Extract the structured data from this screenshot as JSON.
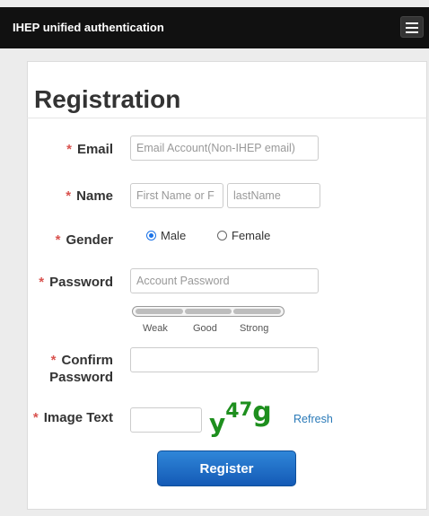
{
  "header": {
    "brand": "IHEP unified authentication",
    "menu_icon": "hamburger-menu-icon"
  },
  "form": {
    "title": "Registration",
    "required_marker": "*",
    "email": {
      "label": "Email",
      "placeholder": "Email Account(Non-IHEP email)",
      "value": ""
    },
    "name": {
      "label": "Name",
      "first_placeholder": "First Name or F",
      "last_placeholder": "lastName",
      "first_value": "",
      "last_value": ""
    },
    "gender": {
      "label": "Gender",
      "options": [
        "Male",
        "Female"
      ],
      "selected": "Male"
    },
    "password": {
      "label": "Password",
      "placeholder": "Account Password",
      "value": "",
      "strength_labels": [
        "Weak",
        "Good",
        "Strong"
      ]
    },
    "confirm_password": {
      "label_line1": "Confirm",
      "label_line2": "Password",
      "value": ""
    },
    "image_text": {
      "label": "Image Text",
      "value": "",
      "captcha_chars": [
        "y",
        "4",
        "7",
        "g"
      ],
      "refresh_label": "Refresh"
    },
    "register_label": "Register"
  },
  "colors": {
    "header_bg": "#111111",
    "required": "#d9534f",
    "accent": "#1a73e8",
    "link": "#2a7ab8",
    "captcha": "#1e8f1e",
    "button": "#1f6cc4"
  }
}
